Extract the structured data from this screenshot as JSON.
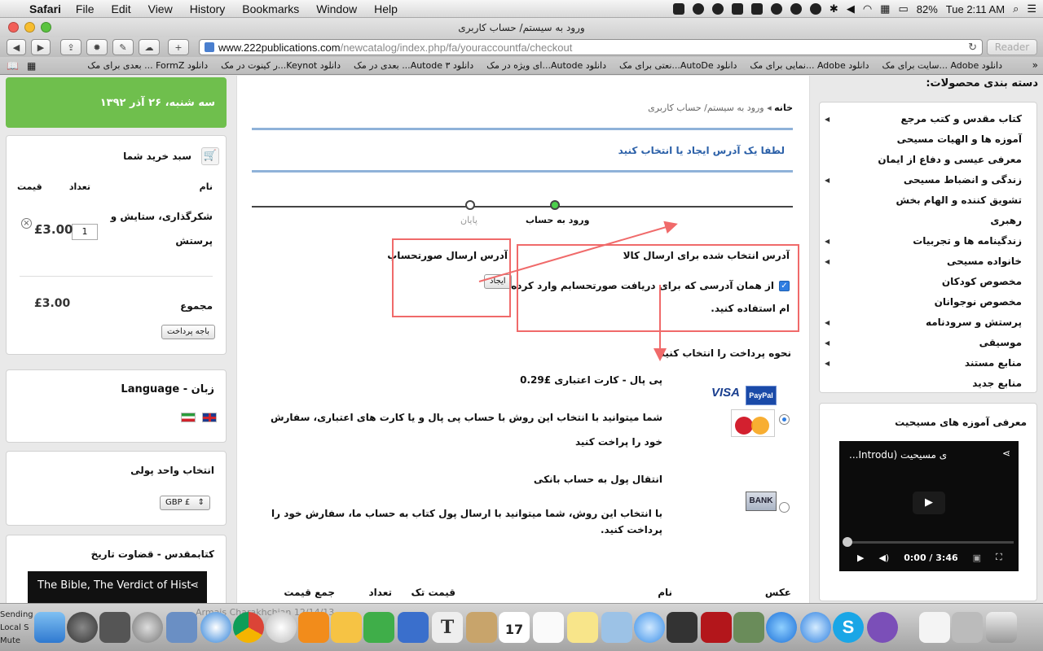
{
  "menubar": {
    "app": "Safari",
    "items": [
      "File",
      "Edit",
      "View",
      "History",
      "Bookmarks",
      "Window",
      "Help"
    ],
    "battery": "82%",
    "clock": "Tue 2:11 AM"
  },
  "window": {
    "title": "ورود به سیستم/ حساب کاربری",
    "url_host": "www.222publications.com",
    "url_path": "/newcatalog/index.php/fa/youraccountfa/checkout",
    "reader": "Reader"
  },
  "bookmarks": [
    "دانلود Adobe ...سایت برای مک",
    "دانلود Adobe ...نمایی برای مک",
    "دانلود AutoDe...نعتی برای مک",
    "دانلود Autode...ای ویژه در مک",
    "دانلود ۳ Autode... بعدی در مک",
    "دانلود Keynot...ر کینوت در مک",
    "دانلود FormZ ... بعدی برای مک"
  ],
  "left": {
    "date": "سه شنبه، ۲۶ آذر ۱۳۹۲",
    "cart": {
      "title": "سبد خرید شما",
      "col_name": "نام",
      "col_qty": "تعداد",
      "col_price": "قیمت",
      "item_line1": "شکرگذاری، ستایش و",
      "item_line2": "پرستش",
      "qty": "1",
      "price": "£3.00",
      "total_label": "مجموع",
      "total_value": "£3.00",
      "checkout": "باجه پرداخت"
    },
    "language_title": "زبان - Language",
    "currency_title": "انتخاب واحد پولی",
    "currency_value": "GBP £",
    "book_title": "کتابمقدس - قضاوت تاریخ",
    "book_video": "The Bible, The Verdict of Hist"
  },
  "center": {
    "breadcrumb_home": "خانه",
    "breadcrumb_current": "ورود به سیستم/ حساب کاربری",
    "heading": "لطفا یک آدرس ایجاد یا انتخاب کنید",
    "step_login": "ورود به حساب",
    "step_end": "پایان",
    "ship_title": "آدرس انتخاب شده برای ارسال کالا",
    "ship_same": "از همان آدرسی که برای دریافت صورتحسابم وارد کرده ام استفاده کنید.",
    "bill_title": "آدرس ارسال صورتحساب",
    "create_btn": "ایجاد",
    "pay_title": "نحوه پرداخت را انتخاب کنید",
    "opt1_title": "پی پال - کارت اعتباری £0.29",
    "opt1_desc": "شما میتوانید با انتخاب این روش با حساب پی پال و یا کارت های اعتباری، سفارش خود را پراخت کنید",
    "opt2_title": "انتقال پول به حساب بانکی",
    "opt2_desc": "با انتخاب این روش، شما میتوانید با ارسال پول کتاب به حساب ما، سفارش خود را پرداخت کنید.",
    "logo_visa": "VISA",
    "logo_paypal": "PayPal",
    "logo_bank": "BANK",
    "table": {
      "photo": "عکس",
      "name": "نام",
      "unit": "قیمت تک",
      "qty": "تعداد",
      "total": "جمع قیمت"
    }
  },
  "right": {
    "categories_title": "دسته بندی محصولات:",
    "categories": [
      "کتاب مقدس و کتب مرجع",
      "آموزه ها و الهیات مسیحی",
      "معرفی عیسی و دفاع از ایمان",
      "زندگی و انضباط مسیحی",
      "تشویق کننده و الهام بخش",
      "رهبری",
      "زندگینامه ها و تجربیات",
      "خانواده مسیحی",
      "مخصوص کودکان",
      "مخصوص نوجوانان",
      "پرستش و سرودنامه",
      "موسیقی",
      "منابع مستند",
      "منابع جدید"
    ],
    "intro_title": "معرفی آموزه های مسیحیت",
    "video_title": "...Introdu) ی مسیحیت",
    "video_time": "0:00 / 3:46"
  },
  "dock": {
    "status_lines": [
      "Sending",
      "Local S",
      "Mute"
    ],
    "underlay": "Armais Charakhchian   12/14/13"
  },
  "colors": {
    "green": "#6fbf4d",
    "link_blue": "#2b60a8",
    "annotation_red": "#f06a6a"
  }
}
